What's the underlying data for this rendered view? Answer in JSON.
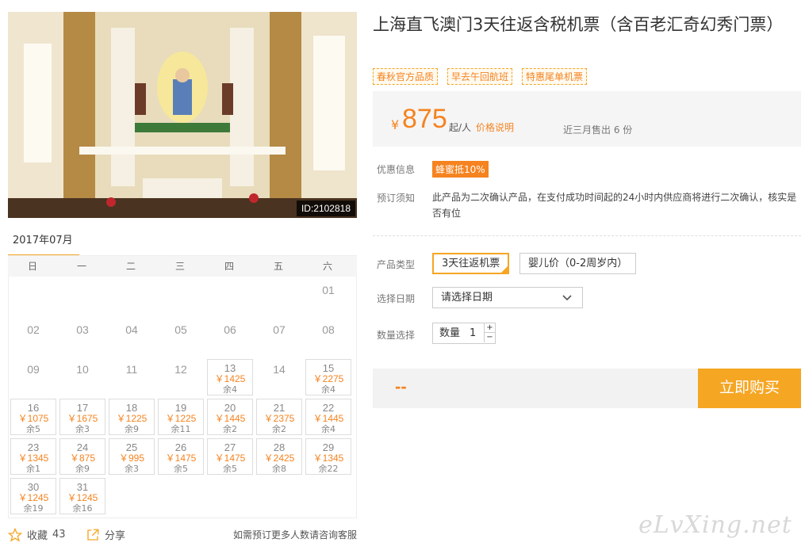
{
  "photo": {
    "id_label": "ID:2102818",
    "alt": "church-interior-photo"
  },
  "calendar": {
    "month": "2017年07月",
    "weekdays": [
      "日",
      "一",
      "二",
      "三",
      "四",
      "五",
      "六"
    ],
    "days": [
      {
        "d": "01",
        "price": "",
        "stock": ""
      },
      {
        "d": "02",
        "price": "",
        "stock": ""
      },
      {
        "d": "03",
        "price": "",
        "stock": ""
      },
      {
        "d": "04",
        "price": "",
        "stock": ""
      },
      {
        "d": "05",
        "price": "",
        "stock": ""
      },
      {
        "d": "06",
        "price": "",
        "stock": ""
      },
      {
        "d": "07",
        "price": "",
        "stock": ""
      },
      {
        "d": "08",
        "price": "",
        "stock": ""
      },
      {
        "d": "09",
        "price": "",
        "stock": ""
      },
      {
        "d": "10",
        "price": "",
        "stock": ""
      },
      {
        "d": "11",
        "price": "",
        "stock": ""
      },
      {
        "d": "12",
        "price": "",
        "stock": ""
      },
      {
        "d": "13",
        "price": "￥1425",
        "stock": "余4"
      },
      {
        "d": "14",
        "price": "",
        "stock": ""
      },
      {
        "d": "15",
        "price": "￥2275",
        "stock": "余4"
      },
      {
        "d": "16",
        "price": "￥1075",
        "stock": "余5"
      },
      {
        "d": "17",
        "price": "￥1675",
        "stock": "余3"
      },
      {
        "d": "18",
        "price": "￥1225",
        "stock": "余9"
      },
      {
        "d": "19",
        "price": "￥1225",
        "stock": "余11"
      },
      {
        "d": "20",
        "price": "￥1445",
        "stock": "余2"
      },
      {
        "d": "21",
        "price": "￥2375",
        "stock": "余2"
      },
      {
        "d": "22",
        "price": "￥1445",
        "stock": "余4"
      },
      {
        "d": "23",
        "price": "￥1345",
        "stock": "余1"
      },
      {
        "d": "24",
        "price": "￥875",
        "stock": "余9"
      },
      {
        "d": "25",
        "price": "￥995",
        "stock": "余3"
      },
      {
        "d": "26",
        "price": "￥1475",
        "stock": "余5"
      },
      {
        "d": "27",
        "price": "￥1475",
        "stock": "余5"
      },
      {
        "d": "28",
        "price": "￥2425",
        "stock": "余8"
      },
      {
        "d": "29",
        "price": "￥1345",
        "stock": "余22"
      },
      {
        "d": "30",
        "price": "￥1245",
        "stock": "余19"
      },
      {
        "d": "31",
        "price": "￥1245",
        "stock": "余16"
      }
    ]
  },
  "bottom": {
    "fav_label": "收藏",
    "fav_count": "43",
    "share_label": "分享",
    "consult": "如需预订更多人数请咨询客服"
  },
  "product": {
    "title": "上海直飞澳门3天往返含税机票（含百老汇奇幻秀门票）",
    "tags": [
      "春秋官方品质",
      "早去午回航班",
      "特惠尾单机票"
    ],
    "currency": "¥",
    "price": "875",
    "price_unit": "起/人",
    "price_explain": "价格说明",
    "sold": "近三月售出 6 份"
  },
  "info": {
    "promo_label": "优惠信息",
    "promo_badge": "蜂蜜抵10%",
    "notice_label": "预订须知",
    "notice_text": "此产品为二次确认产品，在支付成功时间起的24小时内供应商将进行二次确认，核实是否有位"
  },
  "form": {
    "type_label": "产品类型",
    "type_options": [
      "3天往返机票",
      "婴儿价（0-2周岁内）"
    ],
    "date_label": "选择日期",
    "date_placeholder": "请选择日期",
    "qty_label": "数量选择",
    "qty_prefix": "数量",
    "qty_value": "1",
    "plus": "+",
    "minus": "−"
  },
  "buy": {
    "total": "--",
    "button": "立即购买"
  },
  "watermark": "eLvXing.net",
  "colors": {
    "accent": "#f5a623",
    "price": "#f5831f"
  }
}
